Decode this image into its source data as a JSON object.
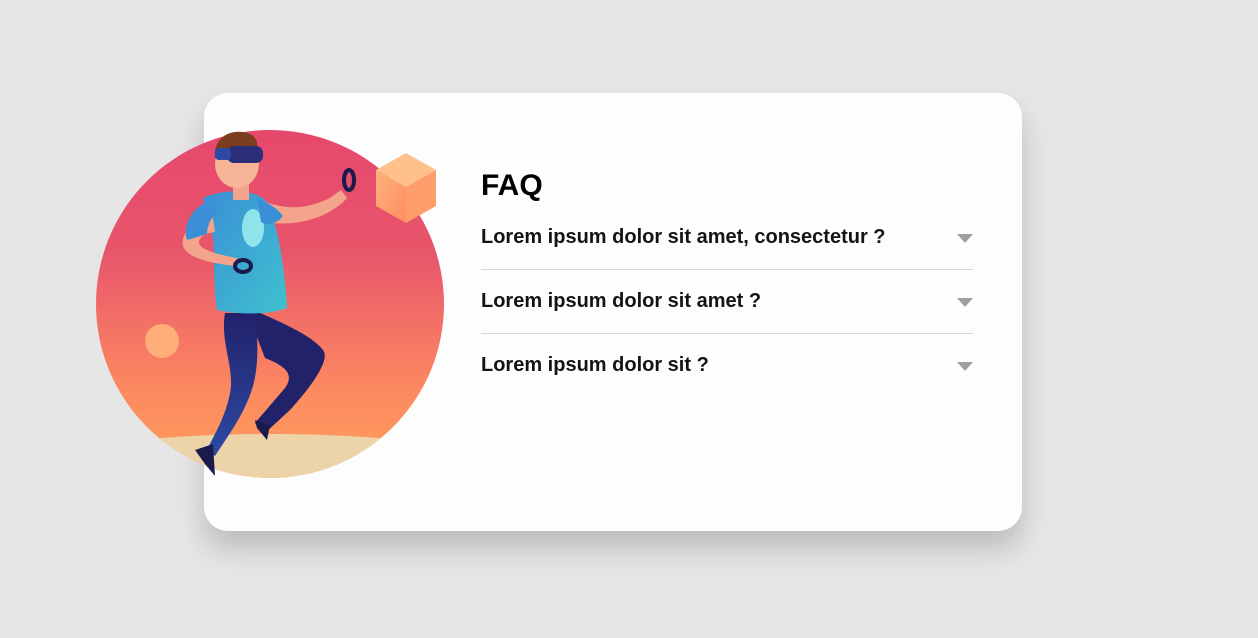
{
  "faq": {
    "title": "FAQ",
    "items": [
      {
        "question": "Lorem ipsum dolor sit amet, consectetur ?",
        "icon": "caret-down-icon"
      },
      {
        "question": "Lorem ipsum dolor sit amet ?",
        "icon": "caret-down-icon"
      },
      {
        "question": "Lorem ipsum dolor sit ?",
        "icon": "caret-down-icon"
      }
    ]
  },
  "colors": {
    "page_background": "#e6e6e6",
    "card_background": "#fdfdfd",
    "circle_gradient_top": "#e5476d",
    "circle_gradient_bottom": "#ff9b5e",
    "cube": "#ffa468",
    "arrow": "#9e9e9e",
    "divider": "#d6d6d6"
  }
}
